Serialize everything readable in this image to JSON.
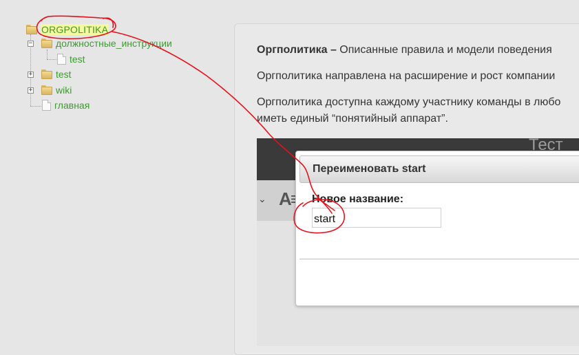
{
  "tree": {
    "root": {
      "label": "ORGPOLITIKA",
      "icon": "folder-open-icon"
    },
    "items": [
      {
        "label": "должностные_инструкции",
        "toggle": "−",
        "icon": "folder-open-icon"
      },
      {
        "label": "test",
        "icon": "page-icon"
      },
      {
        "label": "test",
        "toggle": "+",
        "icon": "folder-icon"
      },
      {
        "label": "wiki",
        "toggle": "+",
        "icon": "folder-icon"
      },
      {
        "label": "главная",
        "icon": "page-icon"
      }
    ],
    "link_color": "#3c9a2e",
    "selected_bg": "#f4f9a0"
  },
  "content": {
    "p1_bold": "Оргполитика –",
    "p1_text": " Описанные правила и модели поведения",
    "p2": "Оргполитика направлена на расширение и рост компании",
    "p3": "Оргполитика доступна каждому участнику команды в любо",
    "p4": "иметь единый “понятийный аппарат”."
  },
  "screenshot": {
    "title": "Тест",
    "chevron": "⌄",
    "format_icon": "A≡"
  },
  "dialog": {
    "title": "Переименовать start",
    "label": "Новое название:",
    "input_value": "start"
  },
  "annotation": {
    "color": "#e8101a"
  }
}
